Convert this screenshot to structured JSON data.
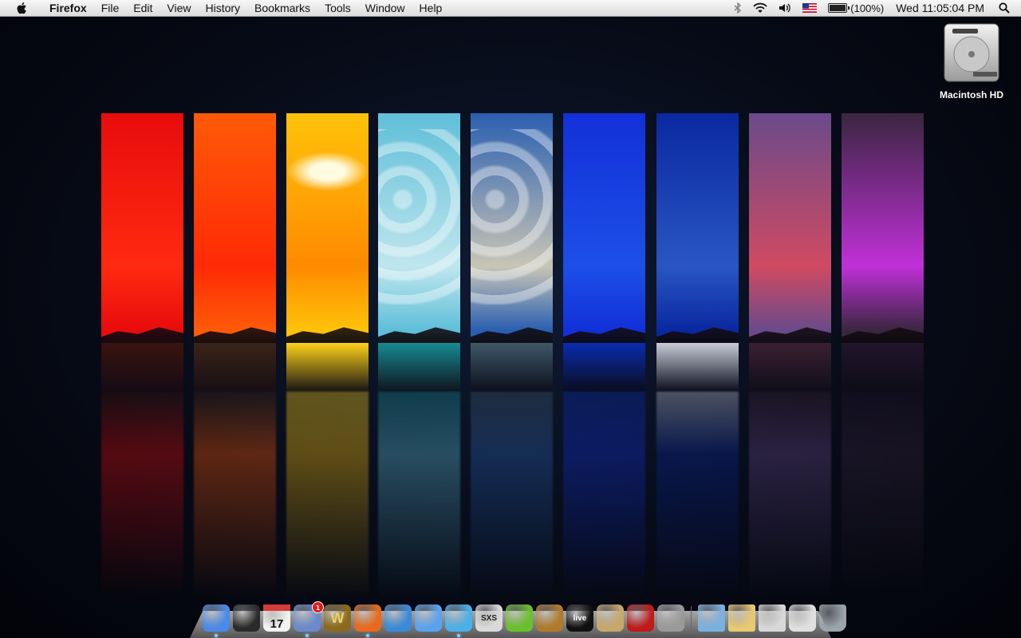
{
  "menubar": {
    "app_name": "Firefox",
    "menus": [
      "File",
      "Edit",
      "View",
      "History",
      "Bookmarks",
      "Tools",
      "Window",
      "Help"
    ],
    "battery": "(100%)",
    "battery_level": 1.0,
    "clock": "Wed 11:05:04 PM",
    "icons": [
      "bluetooth-icon",
      "wifi-icon",
      "volume-icon",
      "us-flag-icon",
      "battery-icon",
      "spotlight-icon"
    ]
  },
  "desktop": {
    "drive_label": "Macintosh HD"
  },
  "wallpaper": {
    "strips": [
      {
        "name": "red-sunset",
        "sky": "#e80c0c",
        "glow": "#ff2a10",
        "water": "#3a1410"
      },
      {
        "name": "orange-sunset",
        "sky": "#ff5a08",
        "glow": "#ff2a06",
        "water": "#3a2418"
      },
      {
        "name": "yellow-sunset",
        "sky": "#ffc20a",
        "glow": "#ff8a00",
        "water": "#ffd21a"
      },
      {
        "name": "teal-sky",
        "sky": "#5fbfd8",
        "glow": "#bfe6ee",
        "water": "#178a92"
      },
      {
        "name": "cloudy-blue",
        "sky": "#2a5fb0",
        "glow": "#c9c5b6",
        "water": "#405868"
      },
      {
        "name": "deep-blue",
        "sky": "#1230d8",
        "glow": "#1d4fe8",
        "water": "#0a2cb0"
      },
      {
        "name": "navy-snow",
        "sky": "#0a28a0",
        "glow": "#2956c4",
        "water": "#c8ccd8"
      },
      {
        "name": "purple-dusk",
        "sky": "#6a4a8a",
        "glow": "#d04a62",
        "water": "#3a2030"
      },
      {
        "name": "violet-night",
        "sky": "#3a2640",
        "glow": "#c030d8",
        "water": "#22152c"
      }
    ]
  },
  "dock": {
    "apps": [
      {
        "name": "finder",
        "icon": "finder-icon",
        "color": "#4a8ae8",
        "running": true
      },
      {
        "name": "dashboard",
        "icon": "dashboard-icon",
        "color": "#2a2a2a",
        "running": false
      },
      {
        "name": "ical",
        "icon": "calendar-icon",
        "color": "#f2f2f2",
        "label": "17",
        "running": false
      },
      {
        "name": "mail",
        "icon": "mail-icon",
        "color": "#6a8acc",
        "badge": "1",
        "running": true
      },
      {
        "name": "world-of-warcraft",
        "icon": "wow-icon",
        "color": "#8a6a1a",
        "label": "W",
        "running": false
      },
      {
        "name": "firefox",
        "icon": "firefox-icon",
        "color": "#e86a1a",
        "running": true
      },
      {
        "name": "safari",
        "icon": "safari-icon",
        "color": "#3a8ad8",
        "running": false
      },
      {
        "name": "ichat",
        "icon": "ichat-icon",
        "color": "#5aa2f0",
        "running": false
      },
      {
        "name": "itunes",
        "icon": "itunes-icon",
        "color": "#4ab0e8",
        "running": true
      },
      {
        "name": "sxs",
        "icon": "snowman-icon",
        "color": "#dadada",
        "label": "SXS",
        "running": false
      },
      {
        "name": "limewire",
        "icon": "lime-icon",
        "color": "#6ac02a",
        "running": false
      },
      {
        "name": "garageband",
        "icon": "guitar-icon",
        "color": "#b07a2a",
        "running": false
      },
      {
        "name": "ableton-live",
        "icon": "live-icon",
        "color": "#111111",
        "label": "live",
        "running": false
      },
      {
        "name": "iphoto",
        "icon": "iphoto-icon",
        "color": "#c8a86a",
        "running": false
      },
      {
        "name": "photo-booth",
        "icon": "photobooth-icon",
        "color": "#c01a1a",
        "running": false
      },
      {
        "name": "system-preferences",
        "icon": "gear-icon",
        "color": "#9a9a9a",
        "running": false
      }
    ],
    "stacks": [
      {
        "name": "applications-stack",
        "icon": "folder-icon",
        "color": "#7ab0e0"
      },
      {
        "name": "documents-stack",
        "icon": "folder-icon",
        "color": "#e8c870"
      },
      {
        "name": "downloads-stack",
        "icon": "folder-icon",
        "color": "#d8d8d8"
      },
      {
        "name": "recent-stack",
        "icon": "stack-icon",
        "color": "#e0e0e0"
      },
      {
        "name": "trash",
        "icon": "trash-icon",
        "color": "#9aa4aa"
      }
    ]
  }
}
